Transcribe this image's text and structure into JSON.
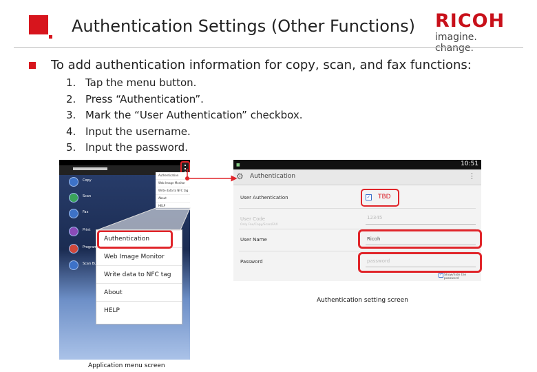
{
  "slide": {
    "title": "Authentication Settings (Other Functions)",
    "brand_name": "RICOH",
    "brand_tagline": "imagine. change.",
    "intro": "To add authentication information for copy, scan, and fax functions:",
    "steps": [
      {
        "num": "1.",
        "text": "Tap the menu button."
      },
      {
        "num": "2.",
        "text": "Press “Authentication”."
      },
      {
        "num": "3.",
        "text": "Mark the “User Authentication” checkbox."
      },
      {
        "num": "4.",
        "text": "Input the username."
      },
      {
        "num": "5.",
        "text": "Input the password."
      }
    ]
  },
  "left_screen": {
    "caption": "Application menu screen",
    "app_rows": [
      "Copy",
      "Scan",
      "Fax",
      "Print",
      "Program",
      "Scan Bus"
    ],
    "small_menu": [
      "Authentication",
      "Web Image Monitor",
      "Write data to NFC tag",
      "About",
      "HELP"
    ],
    "menu_items": [
      "Authentication",
      "Web Image Monitor",
      "Write data to NFC tag",
      "About",
      "HELP"
    ]
  },
  "right_screen": {
    "caption": "Authentication setting screen",
    "clock": "10:51",
    "header": "Authentication",
    "fields": {
      "user_auth_label": "User Authentication",
      "user_auth_annotation": "TBD",
      "user_code_label": "User Code",
      "user_code_sub": "Only Fax/Copy/Scan/FAX",
      "user_code_value": "12345",
      "user_name_label": "User Name",
      "user_name_value": "Ricoh",
      "password_label": "Password",
      "password_placeholder": "password",
      "show_password_label": "Show/hide the password"
    }
  },
  "colors": {
    "accent_red": "#d7151d",
    "checkbox_blue": "#3a6fc9"
  }
}
